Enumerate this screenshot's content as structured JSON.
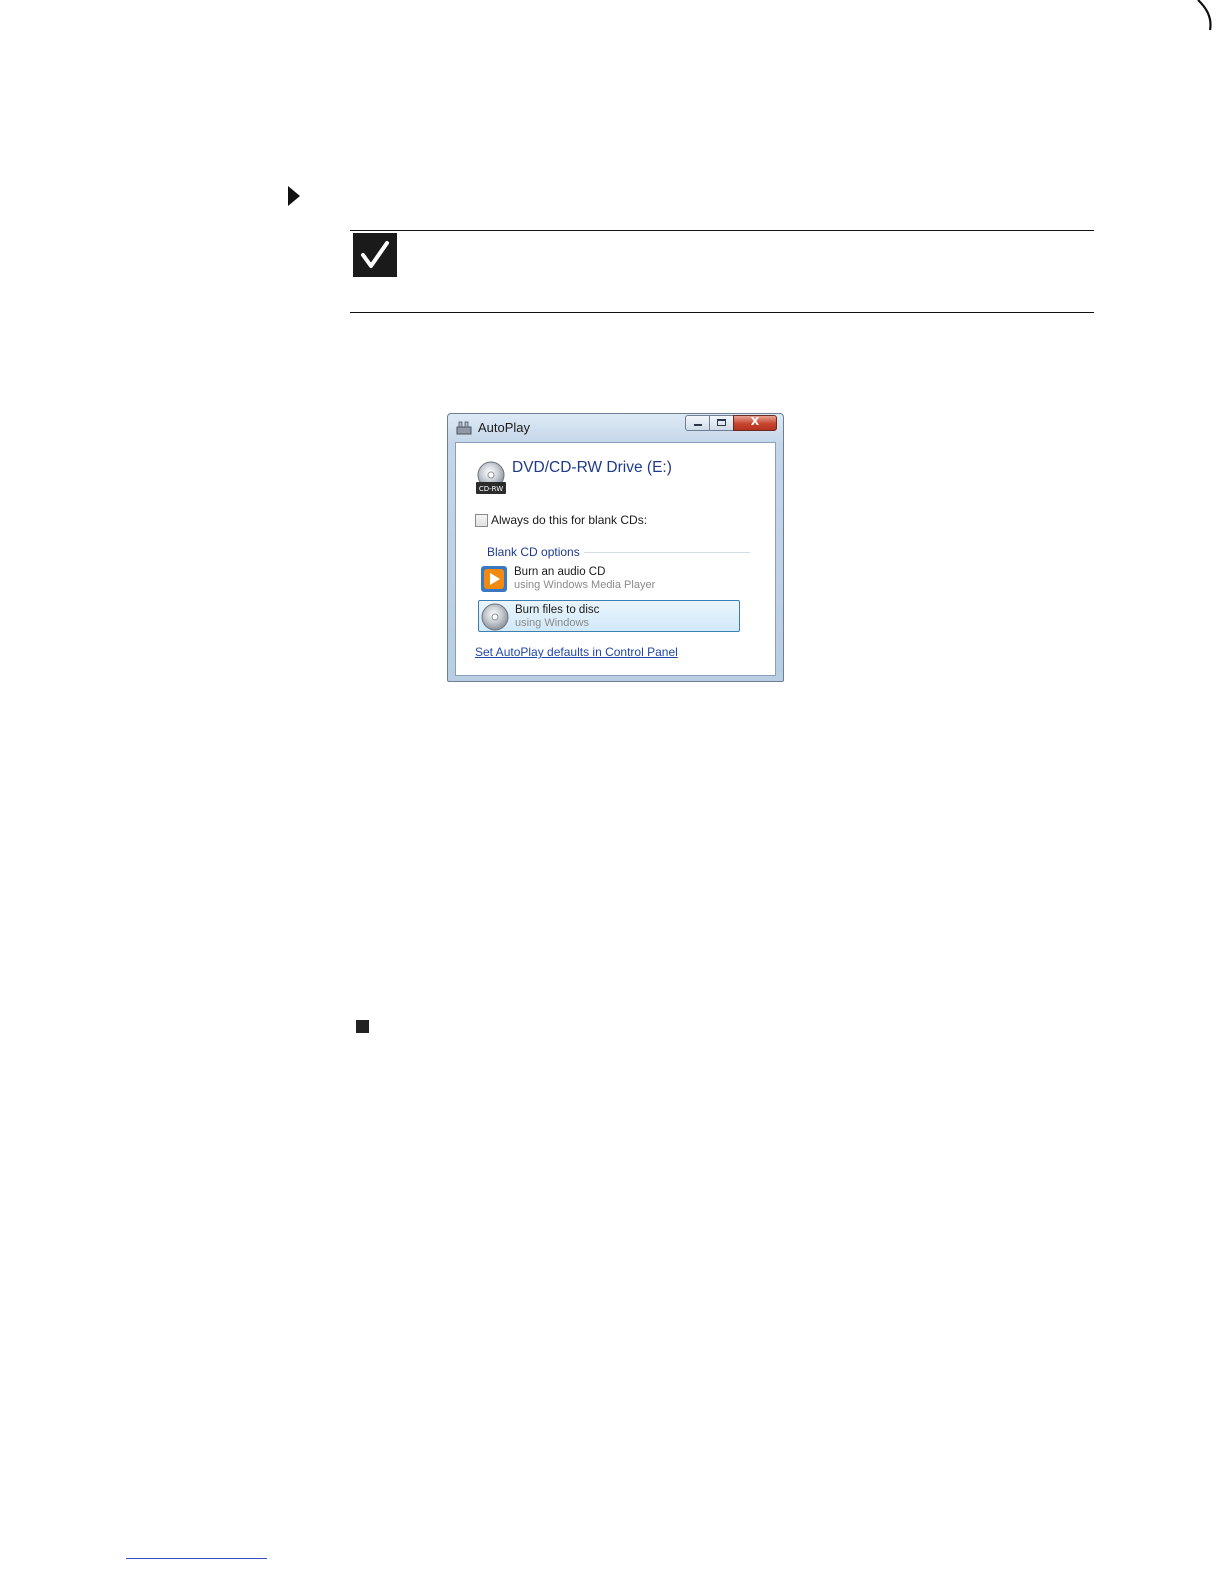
{
  "window": {
    "title": "AutoPlay",
    "drive_title": "DVD/CD-RW Drive (E:)",
    "drive_badge": "CD-RW",
    "always_checkbox": {
      "label": "Always do this for blank CDs:",
      "checked": false
    },
    "options_heading": "Blank CD options",
    "options": [
      {
        "title": "Burn an audio CD",
        "subtitle": "using Windows Media Player",
        "icon": "media-player-icon",
        "selected": false
      },
      {
        "title": "Burn files to disc",
        "subtitle": "using Windows",
        "icon": "disc-icon",
        "selected": true
      }
    ],
    "link": "Set AutoPlay defaults in Control Panel",
    "close_glyph": "X"
  },
  "colors": {
    "heading_blue": "#1e3a8a",
    "link_blue": "#1f47a6",
    "selection_border": "#3c7fb1"
  }
}
